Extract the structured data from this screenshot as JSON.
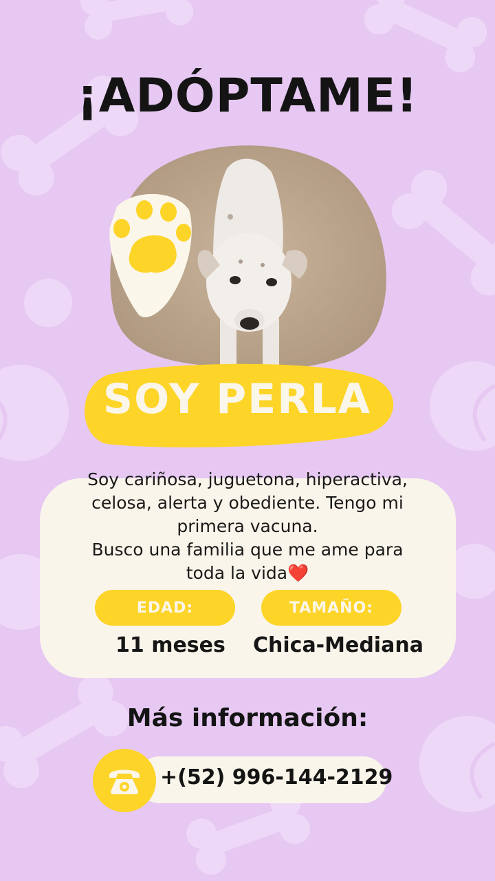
{
  "header": {
    "title": "¡ADÓPTAME!"
  },
  "pet": {
    "name_line": "SOY PERLA",
    "description_line1": "Soy cariñosa, juguetona, hiperactiva,",
    "description_line2": "celosa, alerta y obediente. Tengo mi",
    "description_line3": "primera vacuna.",
    "description_line4": "Busco una familia que me ame para",
    "description_line5": "toda la vida",
    "heart_emoji": "❤️",
    "age_label": "EDAD:",
    "age_value": "11 meses",
    "size_label": "TAMAÑO:",
    "size_value": "Chica-Mediana"
  },
  "contact": {
    "heading": "Más información:",
    "phone": "+(52) 996-144-2129",
    "icon": "telephone-icon"
  },
  "colors": {
    "background": "#e6c8f2",
    "accent_yellow": "#fdd428",
    "card": "#faf5ea",
    "text": "#141414"
  }
}
